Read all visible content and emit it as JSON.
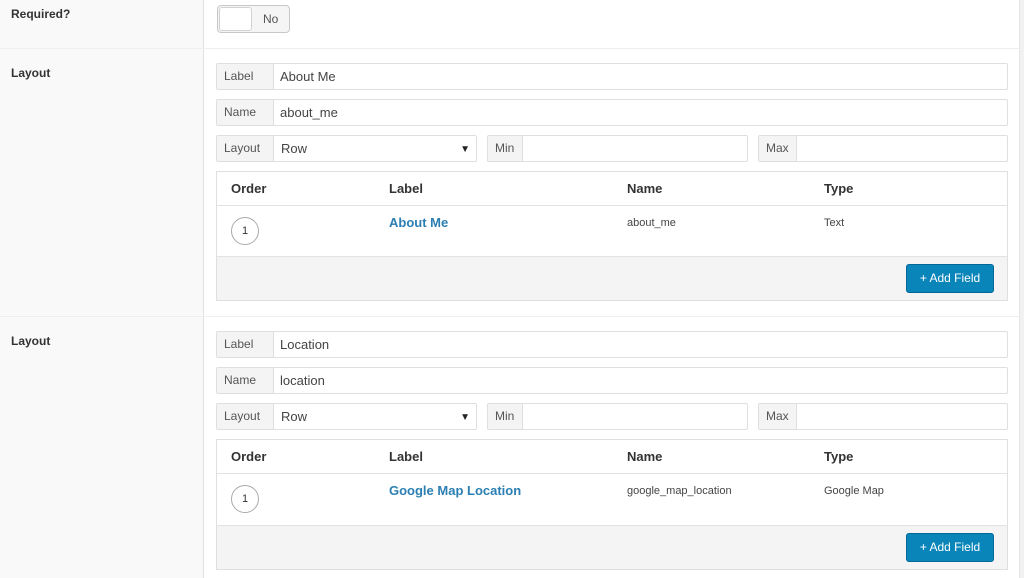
{
  "required": {
    "label": "Required?",
    "toggle_text": "No"
  },
  "layouts": [
    {
      "section_label": "Layout",
      "label_prefix": "Label",
      "label_value": "About Me",
      "name_prefix": "Name",
      "name_value": "about_me",
      "layout_prefix": "Layout",
      "layout_value": "Row",
      "min_prefix": "Min",
      "max_prefix": "Max",
      "columns": [
        "Order",
        "Label",
        "Name",
        "Type"
      ],
      "rows": [
        {
          "order": "1",
          "label": "About Me",
          "name": "about_me",
          "type": "Text"
        }
      ],
      "add_button": "+ Add Field"
    },
    {
      "section_label": "Layout",
      "label_prefix": "Label",
      "label_value": "Location",
      "name_prefix": "Name",
      "name_value": "location",
      "layout_prefix": "Layout",
      "layout_value": "Row",
      "min_prefix": "Min",
      "max_prefix": "Max",
      "columns": [
        "Order",
        "Label",
        "Name",
        "Type"
      ],
      "rows": [
        {
          "order": "1",
          "label": "Google Map Location",
          "name": "google_map_location",
          "type": "Google Map"
        }
      ],
      "add_button": "+ Add Field"
    }
  ],
  "colors": {
    "accent": "#0a85ba",
    "link": "#2b7fb2",
    "label_bg": "#f9f9f9"
  }
}
